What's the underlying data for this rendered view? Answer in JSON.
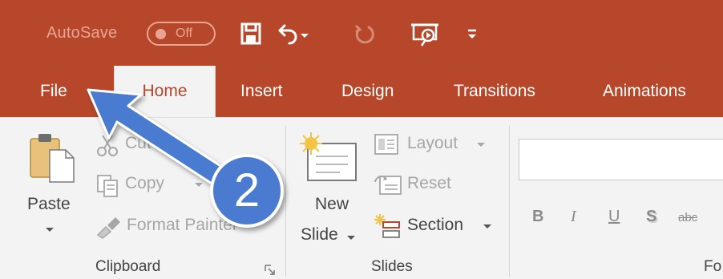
{
  "quick_access": {
    "autosave_label": "AutoSave",
    "autosave_state": "Off",
    "icons": [
      "save-icon",
      "undo-icon",
      "undo-dropdown-icon",
      "redo-icon",
      "start-from-beginning-icon",
      "customize-toolbar-icon"
    ]
  },
  "tabs": [
    {
      "label": "File"
    },
    {
      "label": "Home",
      "active": true
    },
    {
      "label": "Insert"
    },
    {
      "label": "Design"
    },
    {
      "label": "Transitions"
    },
    {
      "label": "Animations"
    }
  ],
  "ribbon": {
    "clipboard": {
      "paste_label": "Paste",
      "cut_label": "Cut",
      "copy_label": "Copy",
      "format_painter_label": "Format Painter",
      "group_label": "Clipboard"
    },
    "slides": {
      "new_slide_line1": "New",
      "new_slide_line2": "Slide",
      "layout_label": "Layout",
      "reset_label": "Reset",
      "section_label": "Section",
      "group_label": "Slides"
    },
    "font": {
      "bold": "B",
      "italic": "I",
      "underline": "U",
      "shadow": "S",
      "strikethrough": "abc",
      "group_label_partial": "Fo"
    }
  },
  "annotation": {
    "step_number": "2",
    "arrow_color": "#4A7BD0",
    "points_to": "File"
  },
  "colors": {
    "brand": "#B7472A",
    "ribbon_bg": "#F3F3F3",
    "disabled_text": "#A6A6A6",
    "annotation_blue": "#4A7BD0"
  }
}
